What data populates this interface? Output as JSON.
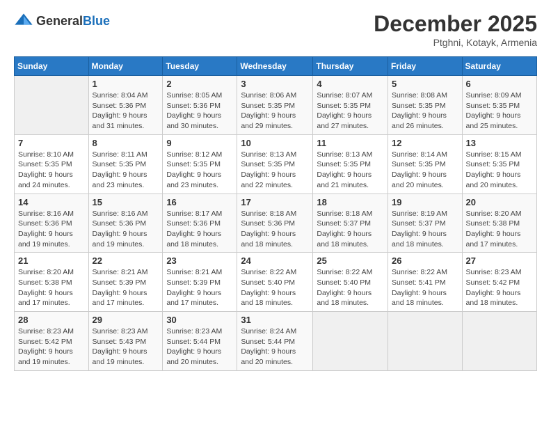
{
  "header": {
    "logo_general": "General",
    "logo_blue": "Blue",
    "month_title": "December 2025",
    "location": "Ptghni, Kotayk, Armenia"
  },
  "weekdays": [
    "Sunday",
    "Monday",
    "Tuesday",
    "Wednesday",
    "Thursday",
    "Friday",
    "Saturday"
  ],
  "weeks": [
    [
      {
        "day": "",
        "info": ""
      },
      {
        "day": "1",
        "info": "Sunrise: 8:04 AM\nSunset: 5:36 PM\nDaylight: 9 hours\nand 31 minutes."
      },
      {
        "day": "2",
        "info": "Sunrise: 8:05 AM\nSunset: 5:36 PM\nDaylight: 9 hours\nand 30 minutes."
      },
      {
        "day": "3",
        "info": "Sunrise: 8:06 AM\nSunset: 5:35 PM\nDaylight: 9 hours\nand 29 minutes."
      },
      {
        "day": "4",
        "info": "Sunrise: 8:07 AM\nSunset: 5:35 PM\nDaylight: 9 hours\nand 27 minutes."
      },
      {
        "day": "5",
        "info": "Sunrise: 8:08 AM\nSunset: 5:35 PM\nDaylight: 9 hours\nand 26 minutes."
      },
      {
        "day": "6",
        "info": "Sunrise: 8:09 AM\nSunset: 5:35 PM\nDaylight: 9 hours\nand 25 minutes."
      }
    ],
    [
      {
        "day": "7",
        "info": "Sunrise: 8:10 AM\nSunset: 5:35 PM\nDaylight: 9 hours\nand 24 minutes."
      },
      {
        "day": "8",
        "info": "Sunrise: 8:11 AM\nSunset: 5:35 PM\nDaylight: 9 hours\nand 23 minutes."
      },
      {
        "day": "9",
        "info": "Sunrise: 8:12 AM\nSunset: 5:35 PM\nDaylight: 9 hours\nand 23 minutes."
      },
      {
        "day": "10",
        "info": "Sunrise: 8:13 AM\nSunset: 5:35 PM\nDaylight: 9 hours\nand 22 minutes."
      },
      {
        "day": "11",
        "info": "Sunrise: 8:13 AM\nSunset: 5:35 PM\nDaylight: 9 hours\nand 21 minutes."
      },
      {
        "day": "12",
        "info": "Sunrise: 8:14 AM\nSunset: 5:35 PM\nDaylight: 9 hours\nand 20 minutes."
      },
      {
        "day": "13",
        "info": "Sunrise: 8:15 AM\nSunset: 5:35 PM\nDaylight: 9 hours\nand 20 minutes."
      }
    ],
    [
      {
        "day": "14",
        "info": "Sunrise: 8:16 AM\nSunset: 5:36 PM\nDaylight: 9 hours\nand 19 minutes."
      },
      {
        "day": "15",
        "info": "Sunrise: 8:16 AM\nSunset: 5:36 PM\nDaylight: 9 hours\nand 19 minutes."
      },
      {
        "day": "16",
        "info": "Sunrise: 8:17 AM\nSunset: 5:36 PM\nDaylight: 9 hours\nand 18 minutes."
      },
      {
        "day": "17",
        "info": "Sunrise: 8:18 AM\nSunset: 5:36 PM\nDaylight: 9 hours\nand 18 minutes."
      },
      {
        "day": "18",
        "info": "Sunrise: 8:18 AM\nSunset: 5:37 PM\nDaylight: 9 hours\nand 18 minutes."
      },
      {
        "day": "19",
        "info": "Sunrise: 8:19 AM\nSunset: 5:37 PM\nDaylight: 9 hours\nand 18 minutes."
      },
      {
        "day": "20",
        "info": "Sunrise: 8:20 AM\nSunset: 5:38 PM\nDaylight: 9 hours\nand 17 minutes."
      }
    ],
    [
      {
        "day": "21",
        "info": "Sunrise: 8:20 AM\nSunset: 5:38 PM\nDaylight: 9 hours\nand 17 minutes."
      },
      {
        "day": "22",
        "info": "Sunrise: 8:21 AM\nSunset: 5:39 PM\nDaylight: 9 hours\nand 17 minutes."
      },
      {
        "day": "23",
        "info": "Sunrise: 8:21 AM\nSunset: 5:39 PM\nDaylight: 9 hours\nand 17 minutes."
      },
      {
        "day": "24",
        "info": "Sunrise: 8:22 AM\nSunset: 5:40 PM\nDaylight: 9 hours\nand 18 minutes."
      },
      {
        "day": "25",
        "info": "Sunrise: 8:22 AM\nSunset: 5:40 PM\nDaylight: 9 hours\nand 18 minutes."
      },
      {
        "day": "26",
        "info": "Sunrise: 8:22 AM\nSunset: 5:41 PM\nDaylight: 9 hours\nand 18 minutes."
      },
      {
        "day": "27",
        "info": "Sunrise: 8:23 AM\nSunset: 5:42 PM\nDaylight: 9 hours\nand 18 minutes."
      }
    ],
    [
      {
        "day": "28",
        "info": "Sunrise: 8:23 AM\nSunset: 5:42 PM\nDaylight: 9 hours\nand 19 minutes."
      },
      {
        "day": "29",
        "info": "Sunrise: 8:23 AM\nSunset: 5:43 PM\nDaylight: 9 hours\nand 19 minutes."
      },
      {
        "day": "30",
        "info": "Sunrise: 8:23 AM\nSunset: 5:44 PM\nDaylight: 9 hours\nand 20 minutes."
      },
      {
        "day": "31",
        "info": "Sunrise: 8:24 AM\nSunset: 5:44 PM\nDaylight: 9 hours\nand 20 minutes."
      },
      {
        "day": "",
        "info": ""
      },
      {
        "day": "",
        "info": ""
      },
      {
        "day": "",
        "info": ""
      }
    ]
  ]
}
